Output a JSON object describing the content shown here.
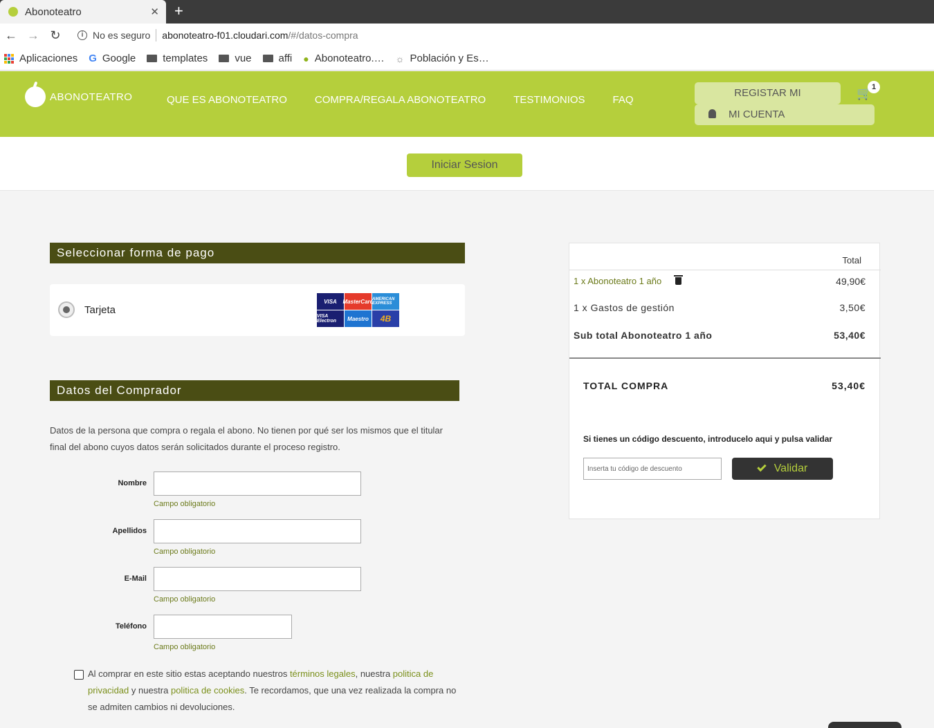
{
  "browser": {
    "tab_title": "Abonoteatro",
    "tab_close": "✕",
    "new_tab": "+",
    "security": "No es seguro",
    "url_host": "abonoteatro-f01.cloudari.com",
    "url_path": "/#/datos-compra",
    "bookmarks": [
      "Aplicaciones",
      "Google",
      "templates",
      "vue",
      "affi",
      "Abonoteatro.…",
      "Población y Es…"
    ]
  },
  "header": {
    "logo": "ABONOTEATRO",
    "nav": [
      "QUE ES ABONOTEATRO",
      "COMPRA/REGALA ABONOTEATRO",
      "TESTIMONIOS",
      "FAQ"
    ],
    "register": "REGISTAR MI ABONOTEATRO",
    "account": "MI CUENTA",
    "cart_count": "1"
  },
  "login": {
    "label": "Iniciar Sesion"
  },
  "payment": {
    "heading": "Seleccionar forma de pago",
    "option": "Tarjeta",
    "cards": [
      "VISA",
      "MasterCard",
      "AMERICAN EXPRESS",
      "VISA Electron",
      "Maestro",
      "4B"
    ]
  },
  "buyer": {
    "heading": "Datos del Comprador",
    "description": "Datos de la persona que compra o regala el abono. No tienen por qué ser los mismos que el titular final del abono cuyos datos serán solicitados durante el proceso registro.",
    "fields": [
      {
        "label": "Nombre",
        "required": "Campo obligatorio"
      },
      {
        "label": "Apellidos",
        "required": "Campo obligatorio"
      },
      {
        "label": "E-Mail",
        "required": "Campo obligatorio"
      },
      {
        "label": "Teléfono",
        "required": "Campo obligatorio"
      }
    ],
    "terms": {
      "t1": "Al comprar en este sitio estas aceptando nuestros ",
      "l1": "términos legales",
      "t2": ", nuestra ",
      "l2": "politica de privacidad",
      "t3": " y nuestra ",
      "l3": "politica de cookies",
      "t4": ". Te recordamos, que una vez realizada la compra no se admiten cambios ni devoluciones."
    }
  },
  "summary": {
    "total_header": "Total",
    "items": [
      {
        "name": "1 x Abonoteatro 1 año",
        "price": "49,90€"
      },
      {
        "name": "1 x Gastos de gestión",
        "price": "3,50€"
      }
    ],
    "subtotal_label": "Sub total Abonoteatro 1 año",
    "subtotal": "53,40€",
    "grand_label": "TOTAL COMPRA",
    "grand": "53,40€",
    "discount_text": "Si tienes un código descuento, introducelo aqui y pulsa validar",
    "discount_placeholder": "Inserta tu código de descuento",
    "validate": "Validar"
  }
}
